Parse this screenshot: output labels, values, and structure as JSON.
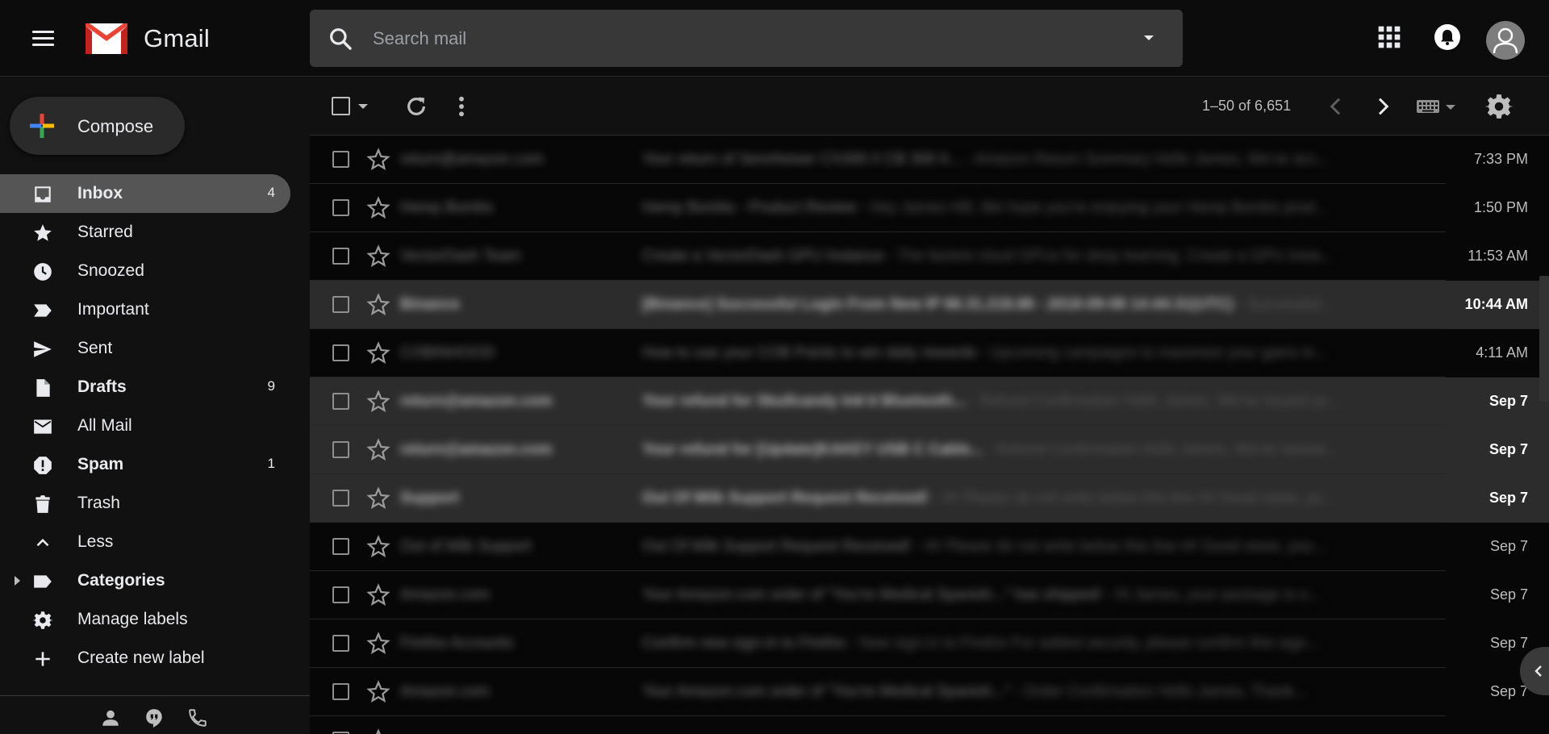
{
  "header": {
    "app_name": "Gmail",
    "search_placeholder": "Search mail"
  },
  "compose": {
    "label": "Compose"
  },
  "sidebar": {
    "items": [
      {
        "label": "Inbox",
        "count": "4",
        "icon": "inbox-icon",
        "bold": true,
        "active": true
      },
      {
        "label": "Starred",
        "count": "",
        "icon": "star-icon",
        "bold": false,
        "active": false
      },
      {
        "label": "Snoozed",
        "count": "",
        "icon": "clock-icon",
        "bold": false,
        "active": false
      },
      {
        "label": "Important",
        "count": "",
        "icon": "important-icon",
        "bold": false,
        "active": false
      },
      {
        "label": "Sent",
        "count": "",
        "icon": "send-icon",
        "bold": false,
        "active": false
      },
      {
        "label": "Drafts",
        "count": "9",
        "icon": "draft-icon",
        "bold": true,
        "active": false
      },
      {
        "label": "All Mail",
        "count": "",
        "icon": "mail-icon",
        "bold": false,
        "active": false
      },
      {
        "label": "Spam",
        "count": "1",
        "icon": "spam-icon",
        "bold": true,
        "active": false
      },
      {
        "label": "Trash",
        "count": "",
        "icon": "trash-icon",
        "bold": false,
        "active": false
      },
      {
        "label": "Less",
        "count": "",
        "icon": "chevron-up-icon",
        "bold": false,
        "active": false
      },
      {
        "label": "Categories",
        "count": "",
        "icon": "label-icon",
        "bold": true,
        "active": false
      },
      {
        "label": "Manage labels",
        "count": "",
        "icon": "gear-icon",
        "bold": false,
        "active": false
      },
      {
        "label": "Create new label",
        "count": "",
        "icon": "plus-icon",
        "bold": false,
        "active": false
      }
    ]
  },
  "toolbar": {
    "pagination": "1–50 of 6,651"
  },
  "emails": [
    {
      "sender": "return@amazon.com",
      "subject": "Your return of Sennheiser CX300 II CB 300 II...",
      "snippet": " - Amazon Return Summary Hello James, We've acc...",
      "date": "7:33 PM",
      "unread": false
    },
    {
      "sender": "Hemp Bombs",
      "subject": "Hemp Bombs - Product Review",
      "snippet": " - Hey James Hill, We hope you're enjoying your Hemp Bombs prod...",
      "date": "1:50 PM",
      "unread": false
    },
    {
      "sender": "VectorDash Team",
      "subject": "Create a VectorDash GPU Instance",
      "snippet": " - The fastest cloud GPUs for deep learning. Create a GPU insta...",
      "date": "11:53 AM",
      "unread": false
    },
    {
      "sender": "Binance",
      "subject": "[Binance] Successful Login From New IP 66.31.218.88 - 2018-09-08 14:44:31(UTC)",
      "snippet": " - Successful...",
      "date": "10:44 AM",
      "unread": true
    },
    {
      "sender": "COBINHOOD",
      "subject": "How to use your COB Points to win daily rewards",
      "snippet": " - Upcoming campaigns to maximize your gains in...",
      "date": "4:11 AM",
      "unread": false
    },
    {
      "sender": "return@amazon.com",
      "subject": "Your refund for Skullcandy Ink'd Bluetooth...",
      "snippet": " - Refund Confirmation Hello James, We've issued yo...",
      "date": "Sep 7",
      "unread": true
    },
    {
      "sender": "return@amazon.com",
      "subject": "Your refund for [Update]KAKEY USB C Cable...",
      "snippet": " - Refund Confirmation Hello James, We've issued...",
      "date": "Sep 7",
      "unread": true
    },
    {
      "sender": "Support",
      "subject": "Out Of Milk Support Request Received!",
      "snippet": " - ## Please do not write below this line ## Good news, yo...",
      "date": "Sep 7",
      "unread": true
    },
    {
      "sender": "Out of Milk Support",
      "subject": "Out Of Milk Support Request Received!",
      "snippet": " - ## Please do not write below this line ## Good news, you...",
      "date": "Sep 7",
      "unread": false
    },
    {
      "sender": "Amazon.com",
      "subject": "Your Amazon.com order of \"You're Medical Spanish...\" has shipped!",
      "snippet": " - Hi James, your package is o...",
      "date": "Sep 7",
      "unread": false
    },
    {
      "sender": "Firefox Accounts",
      "subject": "Confirm new sign-in to Firefox",
      "snippet": " - New sign-in to Firefox For added security, please confirm this sign...",
      "date": "Sep 7",
      "unread": false
    },
    {
      "sender": "Amazon.com",
      "subject": "Your Amazon.com order of \"You're Medical Spanish...\"",
      "snippet": " - Order Confirmation Hello James, Thank...",
      "date": "Sep 7",
      "unread": false
    },
    {
      "sender": "",
      "subject": "",
      "snippet": "",
      "date": "",
      "unread": false
    }
  ],
  "colors": {
    "background": "#111111",
    "header_bg": "#0c0c0c",
    "search_bg": "#383838",
    "active_nav": "#555555",
    "unread_row": "#2c2c2c",
    "read_row": "#070707",
    "text": "#e8eaed"
  }
}
